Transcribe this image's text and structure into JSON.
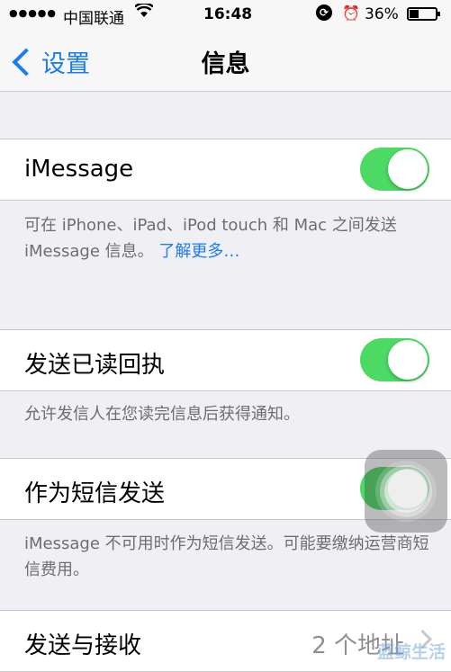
{
  "status_bar": {
    "signal": "●●●●●",
    "carrier": "中国联通",
    "time": "16:48",
    "battery_percent": "36%",
    "battery_level": 0.36,
    "icons": [
      "wifi-icon",
      "rotation-lock-icon",
      "alarm-icon",
      "battery-icon"
    ]
  },
  "nav": {
    "back_label": "设置",
    "title": "信息"
  },
  "imessage": {
    "label": "iMessage",
    "toggle_on": true,
    "footer_text": "可在 iPhone、iPad、iPod touch 和 Mac 之间发送 iMessage 信息。",
    "footer_link": "了解更多…"
  },
  "read_receipts": {
    "label": "发送已读回执",
    "toggle_on": true,
    "footer_text": "允许发信人在您读完信息后获得通知。"
  },
  "send_as_sms": {
    "label": "作为短信发送",
    "toggle_on": true,
    "footer_text": "iMessage 不可用时作为短信发送。可能要缴纳运营商短信费用。"
  },
  "send_receive": {
    "label": "发送与接收",
    "value": "2 个地址"
  },
  "watermark": "蓝鲸生活",
  "colors": {
    "accent": "#1c7cf4",
    "toggle_on": "#4cd964",
    "background": "#efeff4"
  }
}
